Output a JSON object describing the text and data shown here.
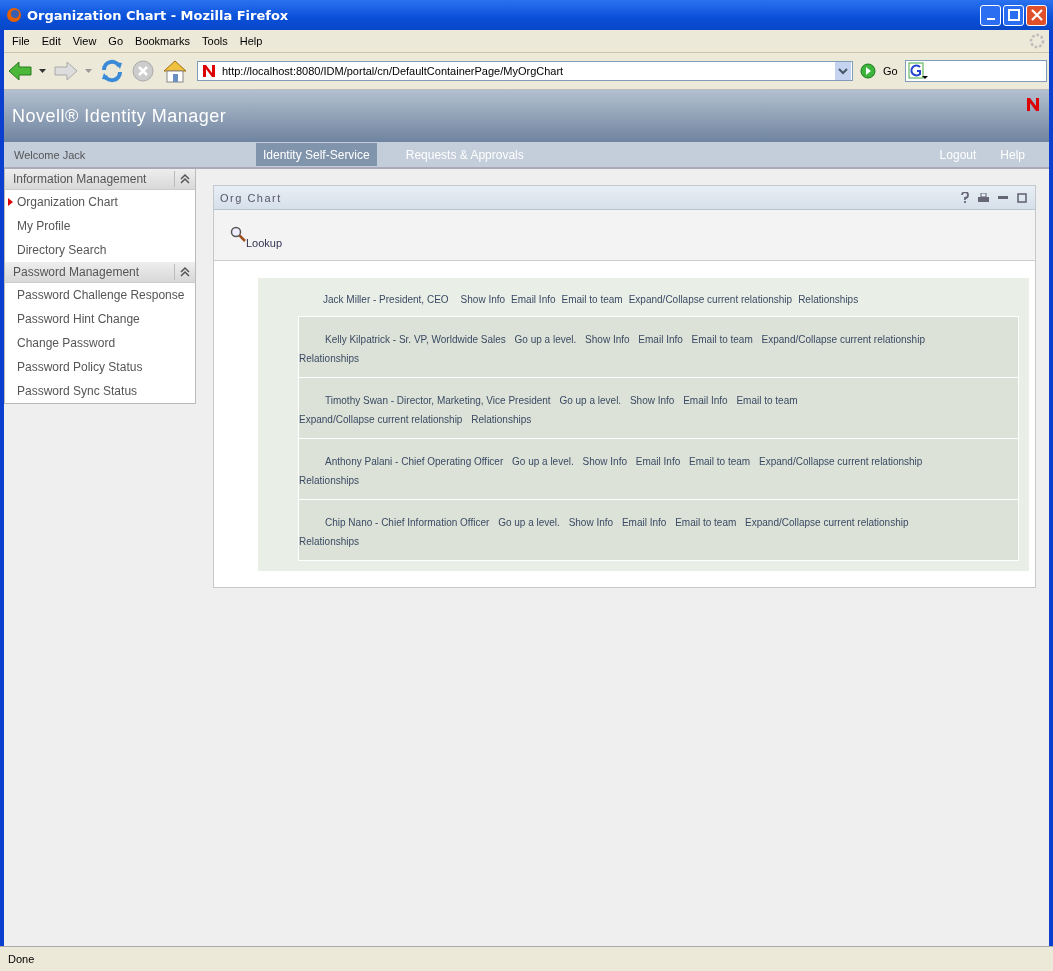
{
  "window": {
    "title": "Organization Chart - Mozilla Firefox"
  },
  "menu": [
    "File",
    "Edit",
    "View",
    "Go",
    "Bookmarks",
    "Tools",
    "Help"
  ],
  "toolbar": {
    "url": "http://localhost:8080/IDM/portal/cn/DefaultContainerPage/MyOrgChart",
    "go": "Go"
  },
  "app": {
    "brand": "Novell® Identity Manager",
    "welcome": "Welcome Jack",
    "tabs": [
      {
        "label": "Identity Self-Service",
        "selected": true
      },
      {
        "label": "Requests & Approvals",
        "selected": false
      }
    ],
    "links": [
      "Logout",
      "Help"
    ]
  },
  "sidebar": [
    {
      "title": "Information Management",
      "items": [
        {
          "label": "Organization Chart",
          "selected": true
        },
        {
          "label": "My Profile",
          "selected": false
        },
        {
          "label": "Directory Search",
          "selected": false
        }
      ]
    },
    {
      "title": "Password Management",
      "items": [
        {
          "label": "Password Challenge Response",
          "selected": false
        },
        {
          "label": "Password Hint Change",
          "selected": false
        },
        {
          "label": "Change Password",
          "selected": false
        },
        {
          "label": "Password Policy Status",
          "selected": false
        },
        {
          "label": "Password Sync Status",
          "selected": false
        }
      ]
    }
  ],
  "portlet": {
    "title": "Org Chart",
    "lookup": "Lookup",
    "root": {
      "name": "Jack Miller - President, CEO",
      "links": [
        "Show Info",
        "Email Info",
        "Email to team",
        "Expand/Collapse current relationship",
        "Relationships"
      ]
    },
    "children": [
      {
        "name": "Kelly Kilpatrick - Sr. VP, Worldwide Sales",
        "links": [
          "Go up a level.",
          "Show Info",
          "Email Info",
          "Email to team",
          "Expand/Collapse current relationship",
          "Relationships"
        ]
      },
      {
        "name": "Timothy Swan - Director, Marketing, Vice President",
        "links": [
          "Go up a level.",
          "Show Info",
          "Email Info",
          "Email to team",
          "Expand/Collapse current relationship",
          "Relationships"
        ]
      },
      {
        "name": "Anthony Palani - Chief Operating Officer",
        "links": [
          "Go up a level.",
          "Show Info",
          "Email Info",
          "Email to team",
          "Expand/Collapse current relationship",
          "Relationships"
        ]
      },
      {
        "name": "Chip Nano - Chief Information Officer",
        "links": [
          "Go up a level.",
          "Show Info",
          "Email Info",
          "Email to team",
          "Expand/Collapse current relationship",
          "Relationships"
        ]
      }
    ]
  },
  "status_bar": "Done"
}
